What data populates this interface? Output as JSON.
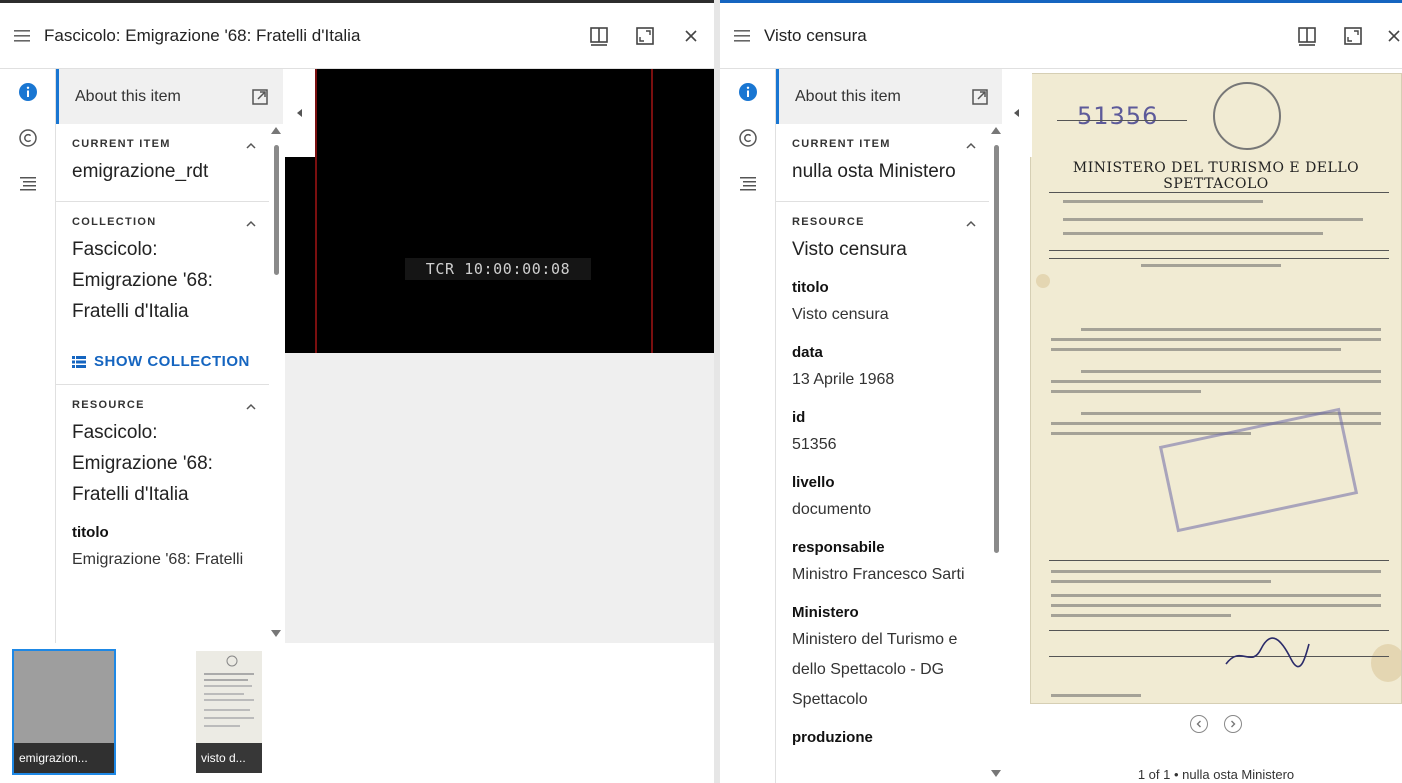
{
  "left": {
    "title": "Fascicolo: Emigrazione '68: Fratelli d'Italia",
    "about": "About this item",
    "sections": {
      "current_item": {
        "label": "CURRENT ITEM",
        "value": "emigrazione_rdt"
      },
      "collection": {
        "label": "COLLECTION",
        "value": "Fascicolo: Emigrazione '68: Fratelli d'Italia",
        "show_label": "SHOW COLLECTION"
      },
      "resource": {
        "label": "RESOURCE",
        "value": "Fascicolo: Emigrazione '68: Fratelli d'Italia"
      }
    },
    "meta": [
      {
        "label": "titolo",
        "value": "Emigrazione '68: Fratelli"
      }
    ],
    "timecode": "TCR 10:00:00:08",
    "thumbnails": [
      {
        "caption": "emigrazion..."
      },
      {
        "caption": "visto d..."
      }
    ]
  },
  "right": {
    "title": "Visto censura",
    "about": "About this item",
    "sections": {
      "current_item": {
        "label": "CURRENT ITEM",
        "value": "nulla osta Ministero"
      },
      "resource": {
        "label": "RESOURCE",
        "value": "Visto censura"
      }
    },
    "meta": [
      {
        "label": "titolo",
        "value": "Visto censura"
      },
      {
        "label": "data",
        "value": "13 Aprile 1968"
      },
      {
        "label": "id",
        "value": "51356"
      },
      {
        "label": "livello",
        "value": "documento"
      },
      {
        "label": "responsabile",
        "value": "Ministro Francesco Sarti"
      },
      {
        "label": "Ministero",
        "value": "Ministero del Turismo e dello Spettacolo - DG Spettacolo"
      },
      {
        "label": "produzione",
        "value": ""
      }
    ],
    "document": {
      "number": "51356",
      "ministry": "MINISTERO DEL TURISMO E DELLO SPETTACOLO"
    },
    "page_label": "1 of 1 • nulla osta Ministero"
  }
}
